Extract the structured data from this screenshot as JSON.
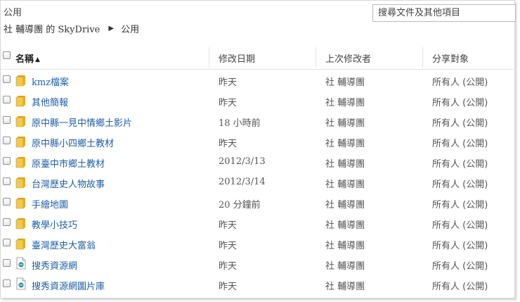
{
  "page": {
    "title": "公用",
    "breadcrumb": {
      "owner": "社 輔導團 的 SkyDrive",
      "current": "公用"
    },
    "search_placeholder": "搜尋文件及其他項目"
  },
  "table": {
    "columns": {
      "name": "名稱",
      "modified": "修改日期",
      "modified_by": "上次修改者",
      "shared_with": "分享對象"
    },
    "sort_indicator": "▲",
    "rows": [
      {
        "type": "folder",
        "name": "kmz檔案",
        "modified": "昨天",
        "modified_by": "社 輔導團",
        "shared_with": "所有人 (公開)"
      },
      {
        "type": "folder",
        "name": "其他簡報",
        "modified": "昨天",
        "modified_by": "社 輔導團",
        "shared_with": "所有人 (公開)"
      },
      {
        "type": "folder",
        "name": "原中縣一見中情鄉土影片",
        "modified": "18 小時前",
        "modified_by": "社 輔導團",
        "shared_with": "所有人 (公開)"
      },
      {
        "type": "folder",
        "name": "原中縣小四鄉土教材",
        "modified": "昨天",
        "modified_by": "社 輔導團",
        "shared_with": "所有人 (公開)"
      },
      {
        "type": "folder",
        "name": "原臺中市鄉土教材",
        "modified": "2012/3/13",
        "modified_by": "社 輔導團",
        "shared_with": "所有人 (公開)"
      },
      {
        "type": "folder",
        "name": "台灣歷史人物故事",
        "modified": "2012/3/14",
        "modified_by": "社 輔導團",
        "shared_with": "所有人 (公開)"
      },
      {
        "type": "folder",
        "name": "手繪地圖",
        "modified": "20 分鐘前",
        "modified_by": "社 輔導團",
        "shared_with": "所有人 (公開)"
      },
      {
        "type": "folder",
        "name": "教學小技巧",
        "modified": "昨天",
        "modified_by": "社 輔導團",
        "shared_with": "所有人 (公開)"
      },
      {
        "type": "folder",
        "name": "臺灣歷史大富翁",
        "modified": "昨天",
        "modified_by": "社 輔導團",
        "shared_with": "所有人 (公開)"
      },
      {
        "type": "link",
        "name": "搜秀資源網",
        "modified": "昨天",
        "modified_by": "社 輔導團",
        "shared_with": "所有人 (公開)"
      },
      {
        "type": "link",
        "name": "搜秀資源網圖片庫",
        "modified": "昨天",
        "modified_by": "社 輔導團",
        "shared_with": "所有人 (公開)"
      }
    ]
  },
  "icons": {
    "folder": "folder-icon",
    "link": "web-link-icon"
  },
  "colors": {
    "link_text": "#1e5fa8",
    "folder_yellow": "#f2c94c",
    "folder_dark": "#d9a526"
  }
}
